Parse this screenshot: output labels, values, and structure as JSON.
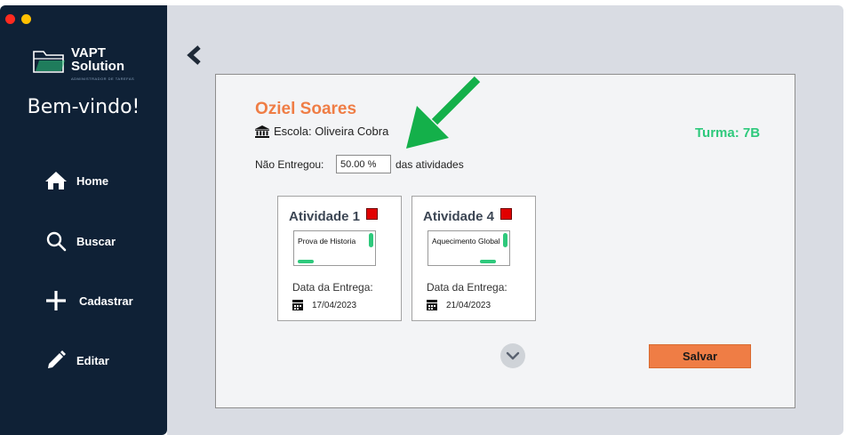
{
  "window": {
    "controls": [
      "close",
      "minimize"
    ]
  },
  "sidebar": {
    "logo_line1": "VAPT",
    "logo_line2": "Solution",
    "logo_sub": "ADMINISTRADOR DE TAREFAS",
    "welcome": "Bem-vindo!",
    "items": [
      {
        "label": "Home",
        "icon": "home-icon"
      },
      {
        "label": "Buscar",
        "icon": "search-icon"
      },
      {
        "label": "Cadastrar",
        "icon": "plus-icon"
      },
      {
        "label": "Editar",
        "icon": "pencil-icon"
      }
    ]
  },
  "student": {
    "name": "Oziel Soares",
    "school": "Escola: Oliveira Cobra",
    "turma": "Turma: 7B",
    "nao_entregou_label": "Não Entregou:",
    "nao_entregou_value": "50.00 %",
    "das_atividades": "das atividades"
  },
  "activities": [
    {
      "title": "Atividade 1",
      "description": "Prova de Historia",
      "due_label": "Data da Entrega:",
      "due_date": "17/04/2023",
      "status_color": "#e10000"
    },
    {
      "title": "Atividade 4",
      "description": "Aquecimento Global",
      "due_label": "Data da Entrega:",
      "due_date": "21/04/2023",
      "status_color": "#e10000"
    }
  ],
  "actions": {
    "save_label": "Salvar"
  },
  "colors": {
    "sidebar": "#0f2136",
    "accent_orange": "#ef7d45",
    "accent_green": "#2ec97c",
    "status_red": "#e10000"
  }
}
